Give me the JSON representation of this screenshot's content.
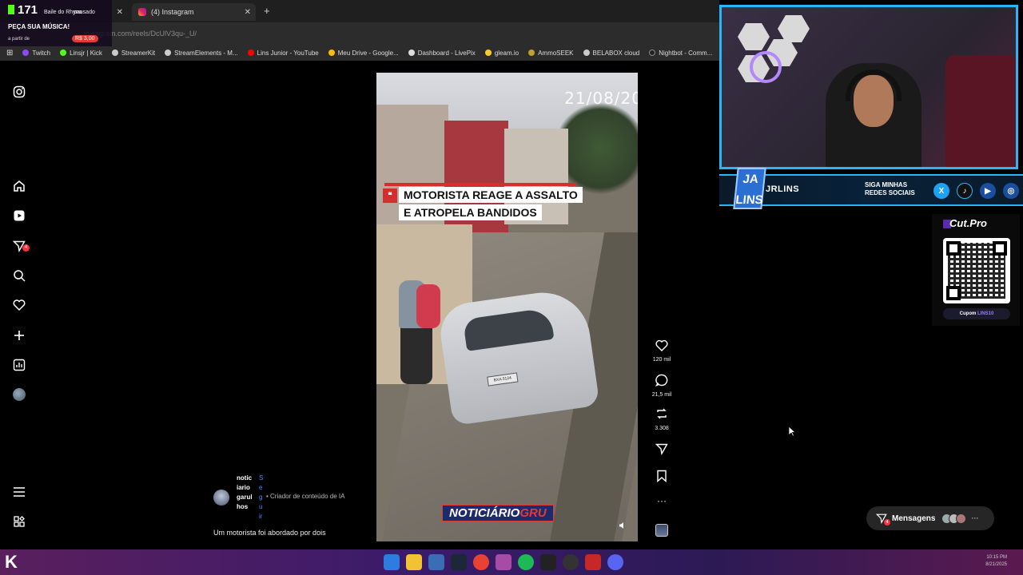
{
  "browser": {
    "tab1": {
      "label": "Baile do Rhyno"
    },
    "tab2": {
      "label": "(4) Instagram"
    },
    "url": "instagram.com/reels/DcUlV3qu-_U/",
    "bookmarks": [
      "Twitch",
      "Linsjr | Kick",
      "StreamerKit",
      "StreamElements - M...",
      "Lins Junior - YouTube",
      "Meu Drive - Google...",
      "Dashboard - LivePix",
      "gleam.io",
      "AmmoSEEK",
      "BELABOX cloud",
      "Nightbot - Comm..."
    ]
  },
  "stream_overlay": {
    "viewer_count": "171",
    "now_playing": "Baile do Rhyno",
    "status": "pausado",
    "request_title": "PEÇA SUA MÚSICA!",
    "from_label": "a partir de",
    "price": "R$ 3,00"
  },
  "reel": {
    "date_stamp": "21/08/20",
    "headline_line1": "MOTORISTA REAGE A ASSALTO",
    "headline_line2": "E ATROPELA BANDIDOS",
    "brand_left": "NOTICIÁRIO",
    "brand_right": "GRU",
    "plate": "BXA 5124"
  },
  "actions": {
    "likes": "120 mil",
    "comments": "21,5 mil",
    "reposts": "3.308"
  },
  "author": {
    "name": "noticiariogarulhos",
    "follow": "Seguir",
    "tag": "• Criador de conteúdo de IA"
  },
  "caption": "Um motorista foi abordado por dois",
  "social": {
    "logo": "JA LINS",
    "handle": "JRLINS",
    "cta": "SIGA MINHAS REDES SOCIAIS"
  },
  "cutpro": {
    "title": "Cut.Pro",
    "coupon_label": "Cupom",
    "coupon_code": "LINS10"
  },
  "messages": {
    "label": "Mensagens",
    "badge": "4"
  },
  "sidebar": {
    "notif_badge": "4"
  },
  "taskbar": {
    "logo": "K",
    "time": "10:15 PM",
    "date": "8/21/2025"
  }
}
